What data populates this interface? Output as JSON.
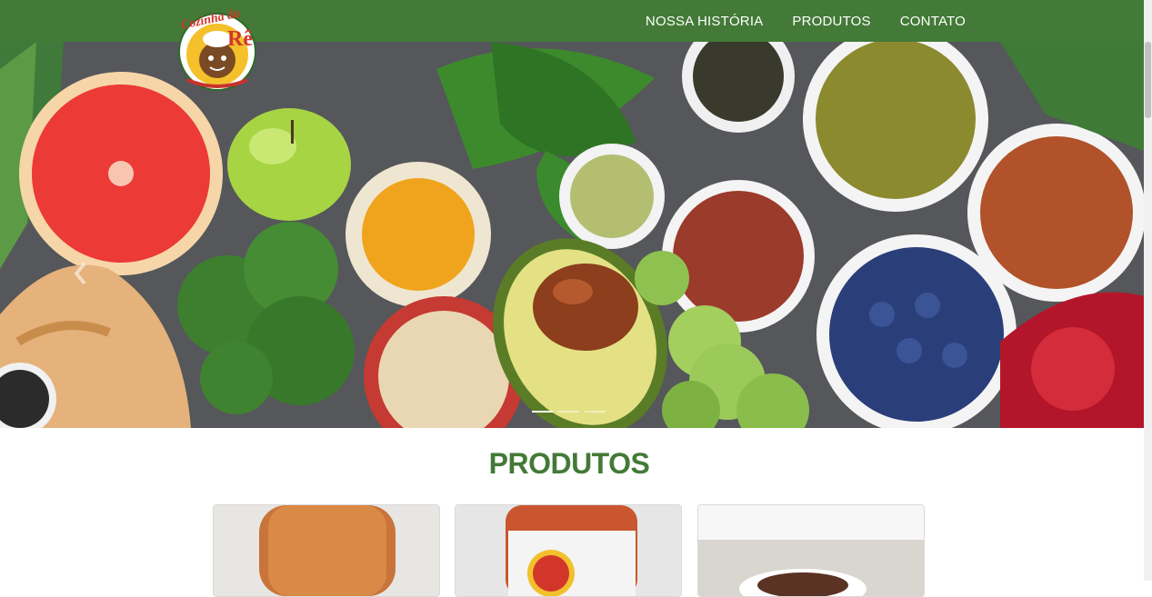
{
  "nav": {
    "items": [
      {
        "label": "NOSSA HISTÓRIA"
      },
      {
        "label": "PRODUTOS"
      },
      {
        "label": "CONTATO"
      }
    ],
    "background": "#437a37"
  },
  "logo": {
    "alt": "Cozinha da Rê",
    "script_text": "Cozinha da",
    "big_letter": "Rê"
  },
  "hero": {
    "slide_count": 3,
    "active_slide": 1
  },
  "products": {
    "title": "PRODUTOS",
    "title_color": "#437a37",
    "cards": [
      {
        "name": "product-card-bread"
      },
      {
        "name": "product-card-homemade-bread"
      },
      {
        "name": "product-card-cake"
      }
    ]
  }
}
